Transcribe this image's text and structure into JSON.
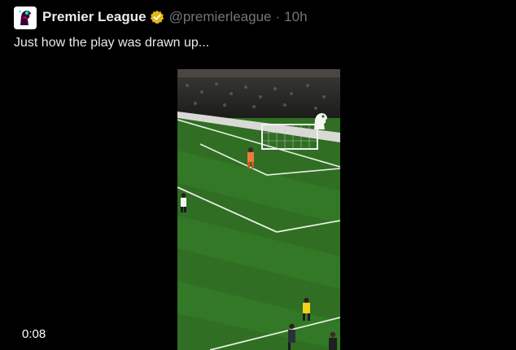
{
  "tweet": {
    "display_name": "Premier League",
    "handle": "@premierleague",
    "separator": "·",
    "time": "10h",
    "text": "Just how the play was drawn up...",
    "verified_color": "#e2b719"
  },
  "media": {
    "type": "video",
    "duration": "0:08",
    "pitch_color": "#2f6e23"
  }
}
